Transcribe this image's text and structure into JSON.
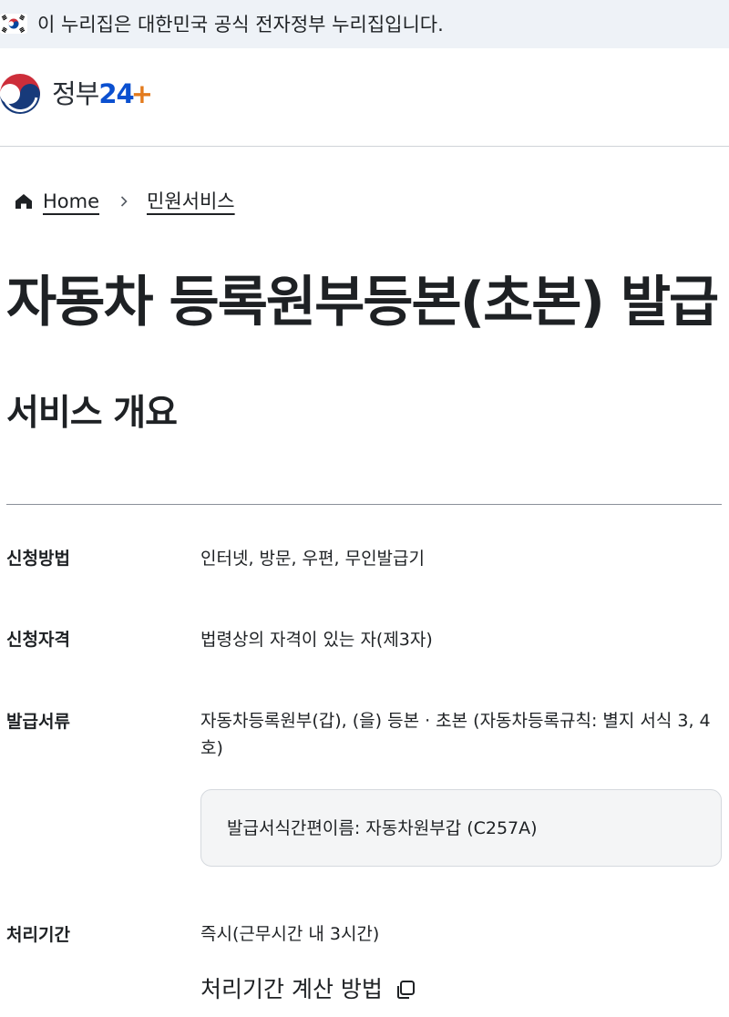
{
  "gov_banner": {
    "text": "이 누리집은 대한민국 공식 전자정부 누리집입니다.",
    "flag_icon": "korea-flag-icon"
  },
  "header": {
    "logo_text": "정부",
    "logo_number": "24",
    "logo_plus": "+"
  },
  "breadcrumb": {
    "home_icon": "home-icon",
    "items": [
      "Home",
      "민원서비스"
    ],
    "separator_icon": "chevron-right-icon"
  },
  "page": {
    "title": "자동차 등록원부등본(초본) 발급",
    "section_title": "서비스 개요"
  },
  "overview": {
    "rows": [
      {
        "label": "신청방법",
        "value": "인터넷, 방문, 우편, 무인발급기"
      },
      {
        "label": "신청자격",
        "value": "법령상의 자격이 있는 자(제3자)"
      },
      {
        "label": "발급서류",
        "value": "자동차등록원부(갑), (을) 등본 · 초본 (자동차등록규칙: 별지 서식 3, 4호)"
      },
      {
        "label": "처리기간",
        "value": "즉시(근무시간 내 3시간)"
      }
    ],
    "info_box": "발급서식간편이름: 자동차원부갑 (C257A)",
    "calc_link": "처리기간 계산 방법",
    "calc_link_icon": "copy-icon"
  },
  "colors": {
    "banner_bg": "#eef2f7",
    "text": "#1e2124",
    "logo_blue": "#0b50d0",
    "logo_orange": "#e37a1c",
    "info_box_bg": "#f4f5f6"
  }
}
